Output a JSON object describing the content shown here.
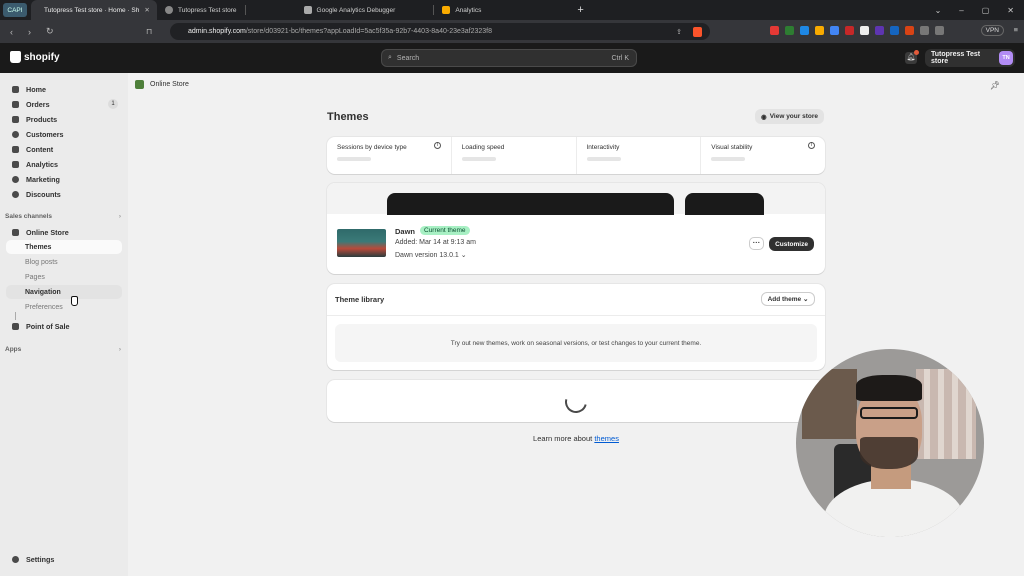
{
  "browser": {
    "tabs": [
      {
        "label": "CAPI"
      },
      {
        "label": "Tutopress Test store · Home · Sh"
      },
      {
        "label": "Tutopress Test store"
      },
      {
        "label": "Google Analytics Debugger"
      },
      {
        "label": "Analytics"
      }
    ],
    "url_host": "admin.shopify.com",
    "url_path": "/store/d03921-bc/themes?appLoadId=5ac5f35a-92b7-4403-8a40-23e3af2323f8",
    "vpn_label": "VPN"
  },
  "topbar": {
    "logo_text": "shopify",
    "search_placeholder": "Search",
    "search_shortcut": "Ctrl K",
    "store_name": "Tutopress Test store",
    "avatar_initials": "TN"
  },
  "sidebar": {
    "items": [
      {
        "label": "Home"
      },
      {
        "label": "Orders",
        "badge": "1"
      },
      {
        "label": "Products"
      },
      {
        "label": "Customers"
      },
      {
        "label": "Content"
      },
      {
        "label": "Analytics"
      },
      {
        "label": "Marketing"
      },
      {
        "label": "Discounts"
      }
    ],
    "sales_channels_label": "Sales channels",
    "online_store_label": "Online Store",
    "sub_items": [
      {
        "label": "Themes"
      },
      {
        "label": "Blog posts"
      },
      {
        "label": "Pages"
      },
      {
        "label": "Navigation"
      },
      {
        "label": "Preferences"
      }
    ],
    "point_of_sale_label": "Point of Sale",
    "apps_label": "Apps",
    "settings_label": "Settings"
  },
  "main": {
    "breadcrumb": "Online Store",
    "title": "Themes",
    "view_store_label": "View your store",
    "metrics": [
      {
        "label": "Sessions by device type"
      },
      {
        "label": "Loading speed"
      },
      {
        "label": "Interactivity"
      },
      {
        "label": "Visual stability"
      }
    ],
    "theme": {
      "name": "Dawn",
      "badge": "Current theme",
      "added": "Added: Mar 14 at 9:13 am",
      "version": "Dawn version 13.0.1",
      "customize_label": "Customize",
      "more_label": "···"
    },
    "library": {
      "title": "Theme library",
      "add_label": "Add theme",
      "empty_text": "Try out new themes, work on seasonal versions, or test changes to your current theme."
    },
    "learn_prefix": "Learn more about",
    "learn_link": "themes"
  },
  "colors": {
    "accent_link": "#005bd3",
    "badge_green": "#a8f0c4",
    "topbar_bg": "#1a1a1a"
  }
}
